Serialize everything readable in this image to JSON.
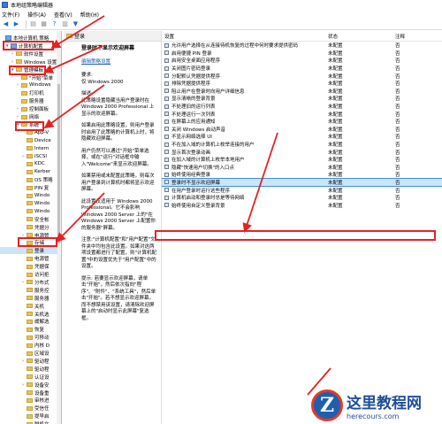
{
  "window": {
    "title": "本地组策略编辑器"
  },
  "menu": [
    "文件(F)",
    "操作(A)",
    "查看(V)",
    "帮助(H)"
  ],
  "tree": [
    {
      "label": "本地计算机 策略",
      "indent": 0,
      "icon": "pc-icon",
      "exp": ""
    },
    {
      "label": "计算机配置",
      "indent": 1,
      "icon": "pc-icon",
      "exp": "▾"
    },
    {
      "label": "软件设置",
      "indent": 2,
      "icon": "folder-icon",
      "exp": "›"
    },
    {
      "label": "Windows 设置",
      "indent": 2,
      "icon": "folder-icon",
      "exp": "›"
    },
    {
      "label": "管理模板",
      "indent": 2,
      "icon": "folder-icon",
      "exp": "▾"
    },
    {
      "label": "\"开始\"菜单",
      "indent": 3,
      "icon": "folder-icon",
      "exp": ""
    },
    {
      "label": "Windows",
      "indent": 3,
      "icon": "folder-icon",
      "exp": "›"
    },
    {
      "label": "打印机",
      "indent": 3,
      "icon": "folder-icon",
      "exp": ""
    },
    {
      "label": "服务器",
      "indent": 3,
      "icon": "folder-icon",
      "exp": ""
    },
    {
      "label": "控制面板",
      "indent": 3,
      "icon": "folder-icon",
      "exp": "›"
    },
    {
      "label": "网络",
      "indent": 3,
      "icon": "folder-icon",
      "exp": "›"
    },
    {
      "label": "系统",
      "indent": 3,
      "icon": "folder-icon",
      "exp": "▾"
    },
    {
      "label": "App-V",
      "indent": 4,
      "icon": "folder-icon",
      "exp": ""
    },
    {
      "label": "Device",
      "indent": 4,
      "icon": "folder-icon",
      "exp": ""
    },
    {
      "label": "Intern",
      "indent": 4,
      "icon": "folder-icon",
      "exp": ""
    },
    {
      "label": "iSCSI",
      "indent": 4,
      "icon": "folder-icon",
      "exp": "›"
    },
    {
      "label": "KDC",
      "indent": 4,
      "icon": "folder-icon",
      "exp": ""
    },
    {
      "label": "Kerber",
      "indent": 4,
      "icon": "folder-icon",
      "exp": ""
    },
    {
      "label": "OS 策略",
      "indent": 4,
      "icon": "folder-icon",
      "exp": ""
    },
    {
      "label": "PIN 复",
      "indent": 4,
      "icon": "folder-icon",
      "exp": ""
    },
    {
      "label": "Windo",
      "indent": 4,
      "icon": "folder-icon",
      "exp": ""
    },
    {
      "label": "Windo",
      "indent": 4,
      "icon": "folder-icon",
      "exp": ""
    },
    {
      "label": "Windo",
      "indent": 4,
      "icon": "folder-icon",
      "exp": ""
    },
    {
      "label": "安全帐",
      "indent": 4,
      "icon": "folder-icon",
      "exp": ""
    },
    {
      "label": "凭据分",
      "indent": 4,
      "icon": "folder-icon",
      "exp": ""
    },
    {
      "label": "电源管",
      "indent": 4,
      "icon": "folder-icon",
      "exp": "›"
    },
    {
      "label": "存储",
      "indent": 4,
      "icon": "folder-icon",
      "exp": ""
    },
    {
      "label": "登录",
      "indent": 4,
      "icon": "folder-icon",
      "exp": "",
      "selected": true
    },
    {
      "label": "电源管",
      "indent": 4,
      "icon": "folder-icon",
      "exp": ""
    },
    {
      "label": "凭据保",
      "indent": 4,
      "icon": "folder-icon",
      "exp": ""
    },
    {
      "label": "访问拒",
      "indent": 4,
      "icon": "folder-icon",
      "exp": ""
    },
    {
      "label": "分布式",
      "indent": 4,
      "icon": "folder-icon",
      "exp": "›"
    },
    {
      "label": "服务控",
      "indent": 4,
      "icon": "folder-icon",
      "exp": ""
    },
    {
      "label": "服务器",
      "indent": 4,
      "icon": "folder-icon",
      "exp": ""
    },
    {
      "label": "关机",
      "indent": 4,
      "icon": "folder-icon",
      "exp": ""
    },
    {
      "label": "关机选",
      "indent": 4,
      "icon": "folder-icon",
      "exp": ""
    },
    {
      "label": "缓解选",
      "indent": 4,
      "icon": "folder-icon",
      "exp": ""
    },
    {
      "label": "恢复",
      "indent": 4,
      "icon": "folder-icon",
      "exp": ""
    },
    {
      "label": "可移动",
      "indent": 4,
      "icon": "folder-icon",
      "exp": ""
    },
    {
      "label": "内核 D",
      "indent": 4,
      "icon": "folder-icon",
      "exp": ""
    },
    {
      "label": "区域设",
      "indent": 4,
      "icon": "folder-icon",
      "exp": ""
    },
    {
      "label": "驱动程",
      "indent": 4,
      "icon": "folder-icon",
      "exp": "›"
    },
    {
      "label": "驱动程",
      "indent": 4,
      "icon": "folder-icon",
      "exp": ""
    },
    {
      "label": "认证设",
      "indent": 4,
      "icon": "folder-icon",
      "exp": ""
    },
    {
      "label": "设备安",
      "indent": 4,
      "icon": "folder-icon",
      "exp": "›"
    },
    {
      "label": "设备重",
      "indent": 4,
      "icon": "folder-icon",
      "exp": ""
    },
    {
      "label": "审核进",
      "indent": 4,
      "icon": "folder-icon",
      "exp": ""
    },
    {
      "label": "受信任",
      "indent": 4,
      "icon": "folder-icon",
      "exp": ""
    },
    {
      "label": "提早启",
      "indent": 4,
      "icon": "folder-icon",
      "exp": ""
    },
    {
      "label": "脱机文",
      "indent": 4,
      "icon": "folder-icon",
      "exp": ""
    }
  ],
  "desc": {
    "header": "登录",
    "title": "登录时不显示欢迎屏幕",
    "link": "编辑策略设置",
    "paragraphs": [
      "要求:\n仅 Windows 2000",
      "描述:\n此策略设置隐藏当用户登录时在 Windows 2000 Professional 上显示的欢迎屏幕。",
      "如果启用此策略设置，则用户登录时启用了此策略的计算机上时，将隐藏欢迎屏幕。",
      "用户仍然可以通过\"开始\"菜单选择，或在\"运行\"对话框中输入\"Welcome\"来显示欢迎屏幕。",
      "如果禁用或未配置此策略，则每次用户登录到计算机时都将显示欢迎屏幕。",
      "此设置仅适用于 Windows 2000 Professional。它不会影响 Windows 2000 Server 上的\"在 Windows 2000 Server 上配置你的服务器\"屏幕。",
      "注意:\"计算机配置\"和\"用户配置\"文件夹中均包含此设置。如果对这两项设置都进行了配置，则\"计算机配置\"中的设置优先于\"用户配置\"中的设置。",
      "提示: 若要显示欢迎屏幕，请单击\"开始\"，然后依次指向\"程序\"、\"附件\"、\"系统工具\"，然后单击\"开始\"。若不想显示欢迎屏幕，而不想禁用该设置，请清除欢迎屏幕上的\"启动时显示此屏幕\"复选框。"
    ]
  },
  "list": {
    "headers": {
      "setting": "设置",
      "state": "状态",
      "note": "注释"
    },
    "rows": [
      {
        "setting": "允许用户选择在从连接待机恢复的过程中何时要求提供密码",
        "state": "未配置",
        "note": "否"
      },
      {
        "setting": "启用便捷 PIN 登录",
        "state": "未配置",
        "note": "否"
      },
      {
        "setting": "启用安全桌面应用程序",
        "state": "未配置",
        "note": "否"
      },
      {
        "setting": "关闭图片密码登录",
        "state": "未配置",
        "note": "否"
      },
      {
        "setting": "分配默认凭据提供程序",
        "state": "未配置",
        "note": "否"
      },
      {
        "setting": "排除凭据提供程序",
        "state": "未配置",
        "note": "否"
      },
      {
        "setting": "阻止用户在登录时向用户详细信息",
        "state": "未配置",
        "note": "否"
      },
      {
        "setting": "显示清晰的登录背景",
        "state": "未配置",
        "note": "否"
      },
      {
        "setting": "不处理旧的运行列表",
        "state": "未配置",
        "note": "否"
      },
      {
        "setting": "不处理运行一次列表",
        "state": "未配置",
        "note": "否"
      },
      {
        "setting": "在屏幕上的应用通知",
        "state": "未配置",
        "note": "否"
      },
      {
        "setting": "关闭 Windows 启动声音",
        "state": "未配置",
        "note": "否"
      },
      {
        "setting": "不显示网络选择 UI",
        "state": "未配置",
        "note": "否"
      },
      {
        "setting": "不在加入域的计算机上枚举连接的用户",
        "state": "未配置",
        "note": "否"
      },
      {
        "setting": "显示首次登录动画",
        "state": "未配置",
        "note": "否"
      },
      {
        "setting": "在加入域的计算机上枚举本地用户",
        "state": "未配置",
        "note": "否"
      },
      {
        "setting": "隐藏\"快速用户切换\"的入口点",
        "state": "未配置",
        "note": "否"
      },
      {
        "setting": "始终使用经典登录",
        "state": "未配置",
        "note": "否"
      },
      {
        "setting": "登录时不显示欢迎屏幕",
        "state": "未配置",
        "note": "否",
        "selected": true
      },
      {
        "setting": "在用户登录时运行这些程序",
        "state": "未配置",
        "note": "否"
      },
      {
        "setting": "计算机启动和登录时总是等待网络",
        "state": "未配置",
        "note": "否"
      },
      {
        "setting": "始终使用自定义登录背景",
        "state": "未配置",
        "note": "否"
      }
    ]
  },
  "watermark": {
    "cn": "这里教程网",
    "en": "herecours.com",
    "logo": "Z"
  },
  "colors": {
    "accent": "#e52222",
    "selection": "#cce4f7"
  }
}
